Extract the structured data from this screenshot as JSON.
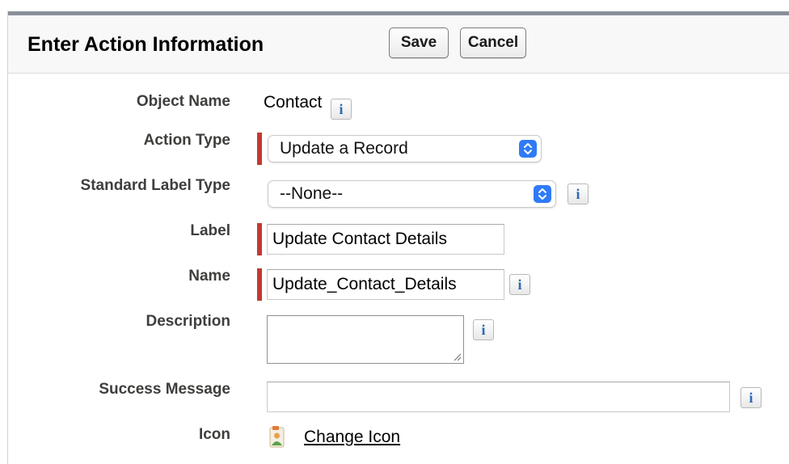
{
  "header": {
    "title": "Enter Action Information",
    "save_label": "Save",
    "cancel_label": "Cancel"
  },
  "fields": {
    "object_name": {
      "label": "Object Name",
      "value": "Contact"
    },
    "action_type": {
      "label": "Action Type",
      "value": "Update a Record"
    },
    "standard_label_type": {
      "label": "Standard Label Type",
      "value": "--None--"
    },
    "label": {
      "label": "Label",
      "value": "Update Contact Details"
    },
    "name": {
      "label": "Name",
      "value": "Update_Contact_Details"
    },
    "description": {
      "label": "Description",
      "value": ""
    },
    "success_message": {
      "label": "Success Message",
      "value": ""
    },
    "icon": {
      "label": "Icon",
      "link": "Change Icon"
    }
  },
  "info_glyph": "i",
  "icons": {
    "info": "info-icon",
    "select_arrows": "updown-chevron-icon",
    "action": "contact-record-icon"
  },
  "colors": {
    "required": "#c23934",
    "select_accent": "#2f7bf6",
    "info_glyph": "#2d6ab1",
    "header_bg": "#f8f8f8",
    "top_border": "#8a8f99"
  }
}
